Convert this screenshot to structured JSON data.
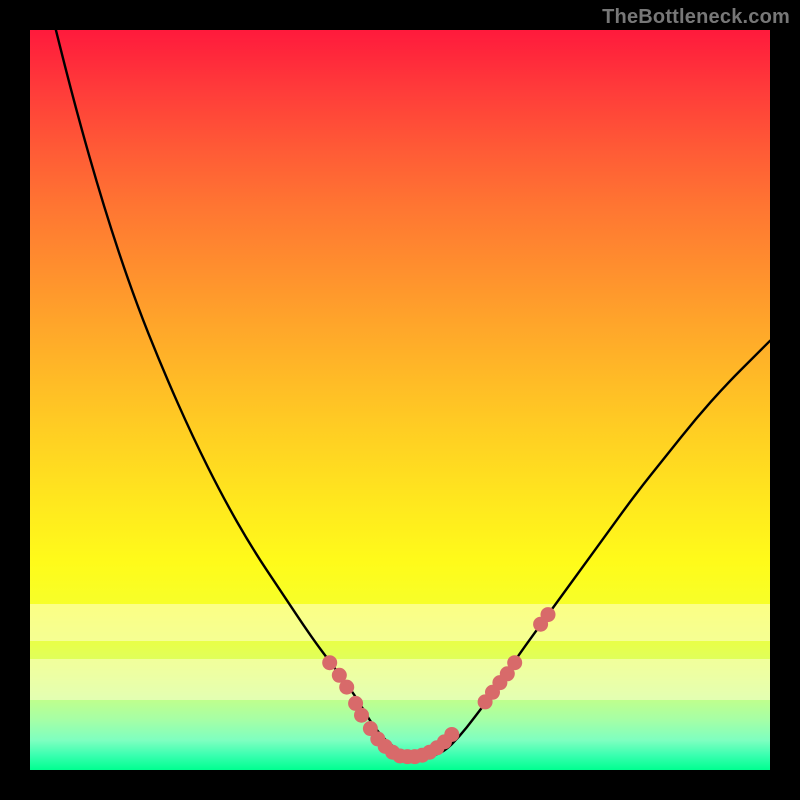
{
  "watermark": "TheBottleneck.com",
  "colors": {
    "frame": "#000000",
    "gradient_top": "#ff1a3c",
    "gradient_bottom": "#00ff90",
    "band": "rgba(255,255,210,0.55)",
    "curve": "#000000",
    "dots": "#d86a6a"
  },
  "chart_data": {
    "type": "line",
    "title": "",
    "xlabel": "",
    "ylabel": "",
    "xlim": [
      0,
      100
    ],
    "ylim": [
      0,
      100
    ],
    "bands_y": [
      {
        "from": 77.5,
        "to": 82.5
      },
      {
        "from": 85.0,
        "to": 90.5
      }
    ],
    "series": [
      {
        "name": "curve",
        "x": [
          2,
          6,
          10,
          14,
          18,
          22,
          26,
          30,
          34,
          38,
          41,
          44,
          46,
          48,
          50,
          52,
          54,
          56,
          58,
          60,
          63,
          66,
          70,
          74,
          78,
          82,
          86,
          90,
          94,
          98,
          100
        ],
        "y": [
          -6,
          10,
          24,
          36,
          46,
          55,
          63,
          70,
          76,
          82,
          86,
          90,
          93.5,
          96,
          97.5,
          98.2,
          98.2,
          97.5,
          95.5,
          93,
          89,
          84.5,
          79,
          73.5,
          68,
          62.5,
          57.5,
          52.5,
          48,
          44,
          42
        ]
      }
    ],
    "dots": [
      {
        "x": 40.5,
        "y": 85.5
      },
      {
        "x": 41.8,
        "y": 87.2
      },
      {
        "x": 42.8,
        "y": 88.8
      },
      {
        "x": 44.0,
        "y": 91.0
      },
      {
        "x": 44.8,
        "y": 92.6
      },
      {
        "x": 46.0,
        "y": 94.4
      },
      {
        "x": 47.0,
        "y": 95.8
      },
      {
        "x": 48.0,
        "y": 96.8
      },
      {
        "x": 49.0,
        "y": 97.6
      },
      {
        "x": 50.0,
        "y": 98.1
      },
      {
        "x": 51.0,
        "y": 98.2
      },
      {
        "x": 52.0,
        "y": 98.2
      },
      {
        "x": 53.0,
        "y": 98.0
      },
      {
        "x": 54.0,
        "y": 97.6
      },
      {
        "x": 55.0,
        "y": 97.0
      },
      {
        "x": 56.0,
        "y": 96.2
      },
      {
        "x": 57.0,
        "y": 95.2
      },
      {
        "x": 61.5,
        "y": 90.8
      },
      {
        "x": 62.5,
        "y": 89.5
      },
      {
        "x": 63.5,
        "y": 88.2
      },
      {
        "x": 64.5,
        "y": 87.0
      },
      {
        "x": 65.5,
        "y": 85.5
      },
      {
        "x": 69.0,
        "y": 80.3
      },
      {
        "x": 70.0,
        "y": 79.0
      }
    ]
  }
}
